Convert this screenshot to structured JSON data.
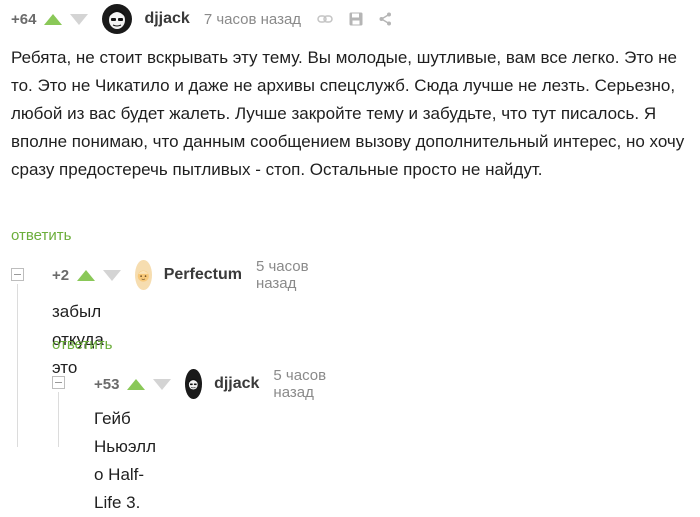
{
  "comments": [
    {
      "rating": "+64",
      "username": "djjack",
      "time": "7 часов назад",
      "text": "Ребята, не стоит вскрывать эту тему. Вы молодые, шутливые, вам все легко. Это не то. Это не Чикатило и даже не архивы спецслужб. Сюда лучше не лезть. Серьезно, любой из вас будет жалеть. Лучше закройте тему и забудьте, что тут писалось. Я вполне понимаю, что данным сообщением вызову дополнительный интерес, но хочу сразу предостеречь пытливых - стоп. Остальные просто не найдут.",
      "reply": "ответить"
    },
    {
      "rating": "+2",
      "username": "Perfectum",
      "time": "5 часов назад",
      "text": "забыл откуда это",
      "reply": "ответить"
    },
    {
      "rating": "+53",
      "username": "djjack",
      "time": "5 часов назад",
      "text": "Гейб Ньюэлл о Half-Life 3."
    }
  ],
  "colors": {
    "upvote": "#8ac858",
    "downvote": "#d4d4d4",
    "reply": "#6cae3b"
  },
  "icons": [
    "arrow-up-icon",
    "arrow-down-icon",
    "link-icon",
    "save-icon",
    "share-icon",
    "collapse-icon"
  ]
}
